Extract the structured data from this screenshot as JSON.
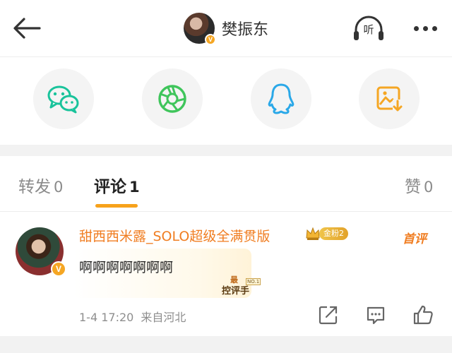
{
  "header": {
    "username": "樊振东",
    "verified_badge": "V",
    "listen_label": "听",
    "icons": {
      "back": "arrow-left-icon",
      "listen": "headphones-icon",
      "more": "more-dots-icon"
    }
  },
  "share": {
    "items": [
      {
        "icon": "wechat-icon",
        "color": "#19c39b"
      },
      {
        "icon": "wechat-moments-icon",
        "color": "#3fc55b"
      },
      {
        "icon": "qq-icon",
        "color": "#2aa8e8"
      },
      {
        "icon": "save-image-icon",
        "color": "#f5a623"
      }
    ]
  },
  "tabs": [
    {
      "label": "转发",
      "count": "0"
    },
    {
      "label": "评论",
      "count": "1"
    },
    {
      "label": "赞",
      "count": "0"
    }
  ],
  "accent": "#f7a21b",
  "comment": {
    "nickname": "甜西西米露_SOLO超级全满贯版",
    "fan_badge": "金粉2",
    "first_label": "首评",
    "text": "啊啊啊啊啊啊啊",
    "deco_top": "最",
    "deco_main": "控评手",
    "deco_no": "NO.1",
    "time": "1-4 17:20",
    "source": "来自河北",
    "verified_badge": "V",
    "actions": [
      "share-icon",
      "comment-icon",
      "like-icon"
    ]
  }
}
